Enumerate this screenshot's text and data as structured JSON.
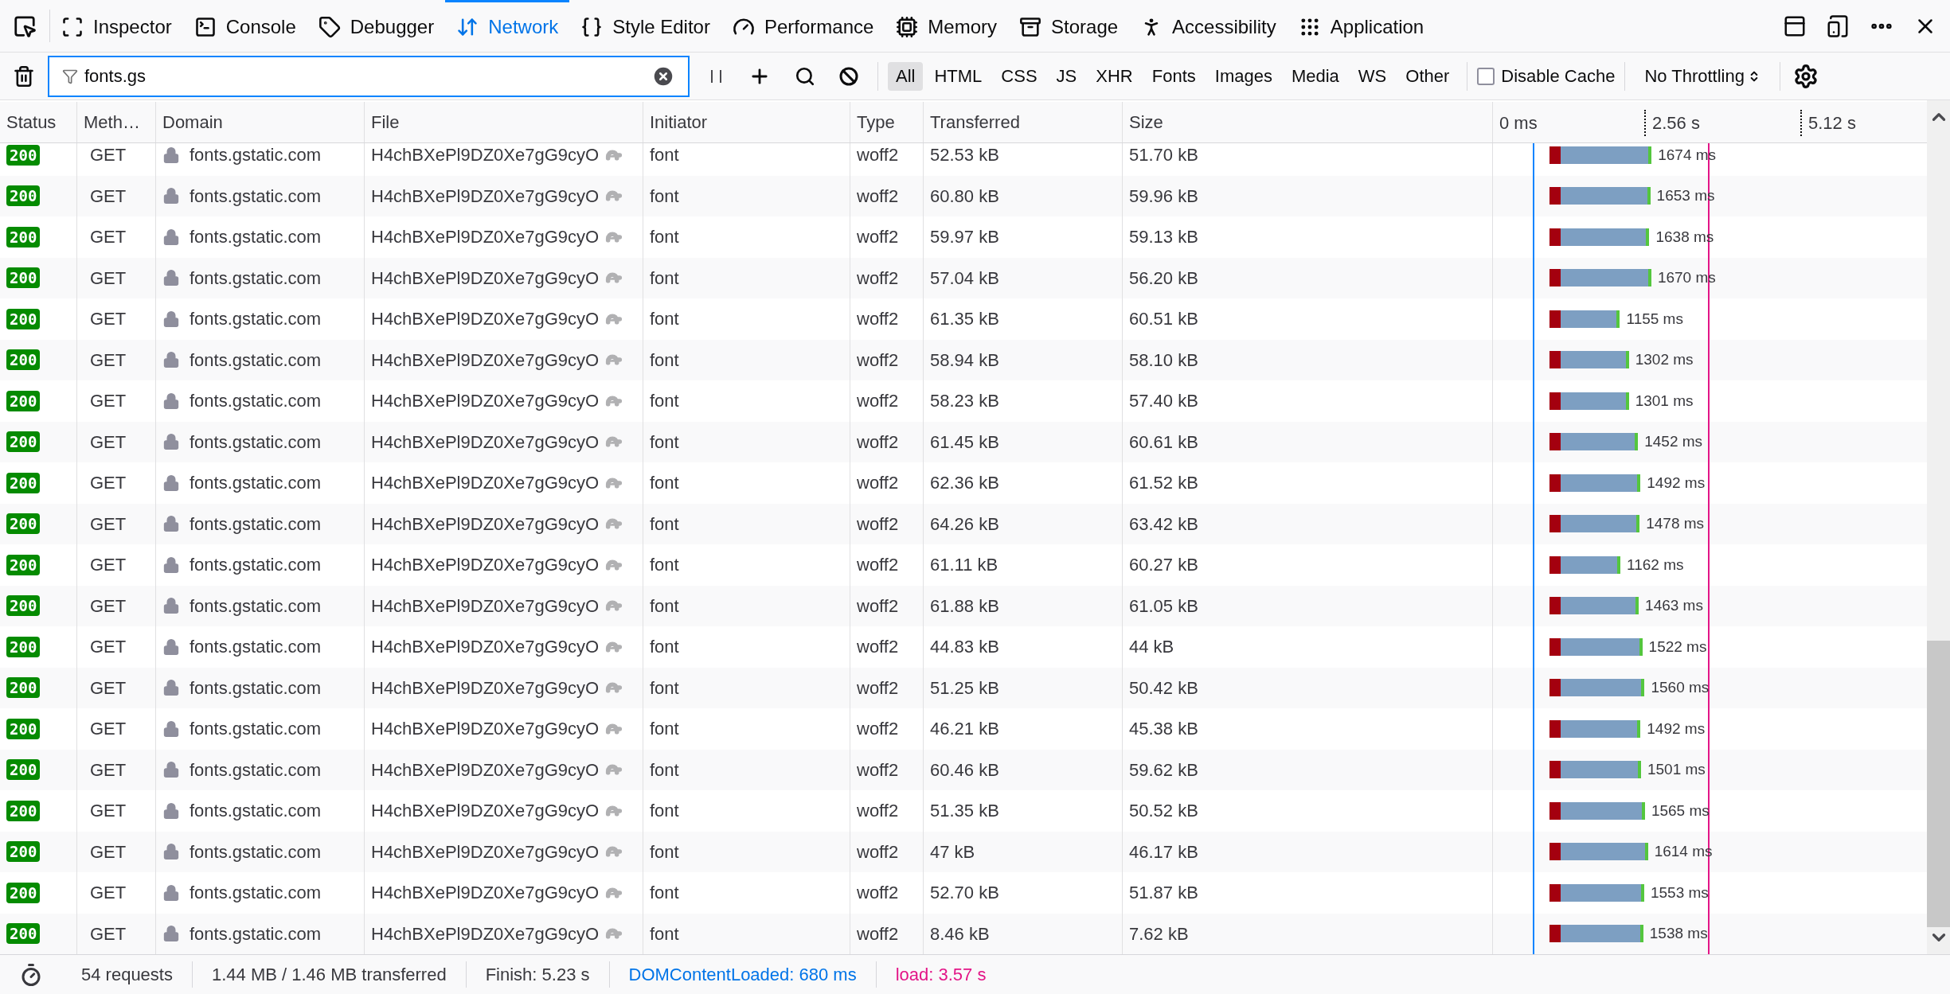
{
  "tabs": [
    {
      "label": "Inspector",
      "selected": false
    },
    {
      "label": "Console",
      "selected": false
    },
    {
      "label": "Debugger",
      "selected": false
    },
    {
      "label": "Network",
      "selected": true
    },
    {
      "label": "Style Editor",
      "selected": false
    },
    {
      "label": "Performance",
      "selected": false
    },
    {
      "label": "Memory",
      "selected": false
    },
    {
      "label": "Storage",
      "selected": false
    },
    {
      "label": "Accessibility",
      "selected": false
    },
    {
      "label": "Application",
      "selected": false
    }
  ],
  "filter": {
    "value": "fonts.gs"
  },
  "type_filters": [
    {
      "label": "All",
      "selected": true
    },
    {
      "label": "HTML",
      "selected": false
    },
    {
      "label": "CSS",
      "selected": false
    },
    {
      "label": "JS",
      "selected": false
    },
    {
      "label": "XHR",
      "selected": false
    },
    {
      "label": "Fonts",
      "selected": false
    },
    {
      "label": "Images",
      "selected": false
    },
    {
      "label": "Media",
      "selected": false
    },
    {
      "label": "WS",
      "selected": false
    },
    {
      "label": "Other",
      "selected": false
    }
  ],
  "disable_cache": {
    "label": "Disable Cache",
    "checked": false
  },
  "throttling": {
    "value": "No Throttling"
  },
  "table": {
    "columns": [
      "Status",
      "Meth…",
      "Domain",
      "File",
      "Initiator",
      "Type",
      "Transferred",
      "Size"
    ],
    "timeline_ticks": [
      "0 ms",
      "2.56 s",
      "5.12 s"
    ],
    "rows": [
      {
        "status": "200",
        "method": "GET",
        "domain": "fonts.gstatic.com",
        "file": "H4chBXePl9DZ0Xe7gG9cyO",
        "initiator": "font",
        "type": "woff2",
        "transferred": "52.53 kB",
        "size": "51.70 kB",
        "time": "1674 ms"
      },
      {
        "status": "200",
        "method": "GET",
        "domain": "fonts.gstatic.com",
        "file": "H4chBXePl9DZ0Xe7gG9cyO",
        "initiator": "font",
        "type": "woff2",
        "transferred": "60.80 kB",
        "size": "59.96 kB",
        "time": "1653 ms"
      },
      {
        "status": "200",
        "method": "GET",
        "domain": "fonts.gstatic.com",
        "file": "H4chBXePl9DZ0Xe7gG9cyO",
        "initiator": "font",
        "type": "woff2",
        "transferred": "59.97 kB",
        "size": "59.13 kB",
        "time": "1638 ms"
      },
      {
        "status": "200",
        "method": "GET",
        "domain": "fonts.gstatic.com",
        "file": "H4chBXePl9DZ0Xe7gG9cyO",
        "initiator": "font",
        "type": "woff2",
        "transferred": "57.04 kB",
        "size": "56.20 kB",
        "time": "1670 ms"
      },
      {
        "status": "200",
        "method": "GET",
        "domain": "fonts.gstatic.com",
        "file": "H4chBXePl9DZ0Xe7gG9cyO",
        "initiator": "font",
        "type": "woff2",
        "transferred": "61.35 kB",
        "size": "60.51 kB",
        "time": "1155 ms"
      },
      {
        "status": "200",
        "method": "GET",
        "domain": "fonts.gstatic.com",
        "file": "H4chBXePl9DZ0Xe7gG9cyO",
        "initiator": "font",
        "type": "woff2",
        "transferred": "58.94 kB",
        "size": "58.10 kB",
        "time": "1302 ms"
      },
      {
        "status": "200",
        "method": "GET",
        "domain": "fonts.gstatic.com",
        "file": "H4chBXePl9DZ0Xe7gG9cyO",
        "initiator": "font",
        "type": "woff2",
        "transferred": "58.23 kB",
        "size": "57.40 kB",
        "time": "1301 ms"
      },
      {
        "status": "200",
        "method": "GET",
        "domain": "fonts.gstatic.com",
        "file": "H4chBXePl9DZ0Xe7gG9cyO",
        "initiator": "font",
        "type": "woff2",
        "transferred": "61.45 kB",
        "size": "60.61 kB",
        "time": "1452 ms"
      },
      {
        "status": "200",
        "method": "GET",
        "domain": "fonts.gstatic.com",
        "file": "H4chBXePl9DZ0Xe7gG9cyO",
        "initiator": "font",
        "type": "woff2",
        "transferred": "62.36 kB",
        "size": "61.52 kB",
        "time": "1492 ms"
      },
      {
        "status": "200",
        "method": "GET",
        "domain": "fonts.gstatic.com",
        "file": "H4chBXePl9DZ0Xe7gG9cyO",
        "initiator": "font",
        "type": "woff2",
        "transferred": "64.26 kB",
        "size": "63.42 kB",
        "time": "1478 ms"
      },
      {
        "status": "200",
        "method": "GET",
        "domain": "fonts.gstatic.com",
        "file": "H4chBXePl9DZ0Xe7gG9cyO",
        "initiator": "font",
        "type": "woff2",
        "transferred": "61.11 kB",
        "size": "60.27 kB",
        "time": "1162 ms"
      },
      {
        "status": "200",
        "method": "GET",
        "domain": "fonts.gstatic.com",
        "file": "H4chBXePl9DZ0Xe7gG9cyO",
        "initiator": "font",
        "type": "woff2",
        "transferred": "61.88 kB",
        "size": "61.05 kB",
        "time": "1463 ms"
      },
      {
        "status": "200",
        "method": "GET",
        "domain": "fonts.gstatic.com",
        "file": "H4chBXePl9DZ0Xe7gG9cyO",
        "initiator": "font",
        "type": "woff2",
        "transferred": "44.83 kB",
        "size": "44 kB",
        "time": "1522 ms"
      },
      {
        "status": "200",
        "method": "GET",
        "domain": "fonts.gstatic.com",
        "file": "H4chBXePl9DZ0Xe7gG9cyO",
        "initiator": "font",
        "type": "woff2",
        "transferred": "51.25 kB",
        "size": "50.42 kB",
        "time": "1560 ms"
      },
      {
        "status": "200",
        "method": "GET",
        "domain": "fonts.gstatic.com",
        "file": "H4chBXePl9DZ0Xe7gG9cyO",
        "initiator": "font",
        "type": "woff2",
        "transferred": "46.21 kB",
        "size": "45.38 kB",
        "time": "1492 ms"
      },
      {
        "status": "200",
        "method": "GET",
        "domain": "fonts.gstatic.com",
        "file": "H4chBXePl9DZ0Xe7gG9cyO",
        "initiator": "font",
        "type": "woff2",
        "transferred": "60.46 kB",
        "size": "59.62 kB",
        "time": "1501 ms"
      },
      {
        "status": "200",
        "method": "GET",
        "domain": "fonts.gstatic.com",
        "file": "H4chBXePl9DZ0Xe7gG9cyO",
        "initiator": "font",
        "type": "woff2",
        "transferred": "51.35 kB",
        "size": "50.52 kB",
        "time": "1565 ms"
      },
      {
        "status": "200",
        "method": "GET",
        "domain": "fonts.gstatic.com",
        "file": "H4chBXePl9DZ0Xe7gG9cyO",
        "initiator": "font",
        "type": "woff2",
        "transferred": "47 kB",
        "size": "46.17 kB",
        "time": "1614 ms"
      },
      {
        "status": "200",
        "method": "GET",
        "domain": "fonts.gstatic.com",
        "file": "H4chBXePl9DZ0Xe7gG9cyO",
        "initiator": "font",
        "type": "woff2",
        "transferred": "52.70 kB",
        "size": "51.87 kB",
        "time": "1553 ms"
      },
      {
        "status": "200",
        "method": "GET",
        "domain": "fonts.gstatic.com",
        "file": "H4chBXePl9DZ0Xe7gG9cyO",
        "initiator": "font",
        "type": "woff2",
        "transferred": "8.46 kB",
        "size": "7.62 kB",
        "time": "1538 ms"
      }
    ]
  },
  "status_bar": {
    "requests": "54 requests",
    "transferred": "1.44 MB / 1.46 MB transferred",
    "finish": "Finish: 5.23 s",
    "dom_content_loaded": "DOMContentLoaded: 680 ms",
    "load": "load: 3.57 s"
  }
}
